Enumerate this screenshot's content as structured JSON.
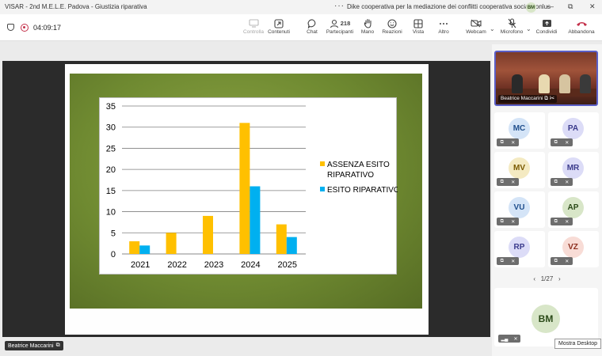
{
  "window": {
    "title": "VISAR - 2nd M.E.L.E. Padova - Giustizia riparativa",
    "organization": "Dike cooperativa per la mediazione dei conflitti cooperativa sociale onlus",
    "user_initials": "BM",
    "more_glyph": "···",
    "minimize_glyph": "—",
    "maximize_glyph": "⧉",
    "close_glyph": "✕"
  },
  "toolbar": {
    "timer": "04:09:17",
    "controlla": "Controlla",
    "contenuti": "Contenuti",
    "chat": "Chat",
    "participants_count": "218",
    "participants": "Partecipanti",
    "mano": "Mano",
    "reazioni": "Reazioni",
    "vista": "Vista",
    "altro": "Altro",
    "webcam": "Webcam",
    "microfono": "Microfono",
    "condividi": "Condividi",
    "abbandona": "Abbandona",
    "icons": {
      "controlla": "monitor-icon",
      "contenuti": "share-content-icon",
      "chat": "chat-icon",
      "participants": "people-icon",
      "mano": "hand-icon",
      "reazioni": "smile-icon",
      "vista": "grid-icon",
      "altro": "more-icon",
      "webcam": "camera-off-icon",
      "microfono": "mic-off-icon",
      "condividi": "share-icon",
      "abbandona": "phone-leave-icon"
    }
  },
  "featured": {
    "name": "Beatrice Maccarini"
  },
  "participants": [
    {
      "initials": "MC",
      "bg": "#d4e4f7",
      "fg": "#1f4e8c"
    },
    {
      "initials": "PA",
      "bg": "#dcdcf7",
      "fg": "#3b3b8c"
    },
    {
      "initials": "MV",
      "bg": "#f4eac2",
      "fg": "#7a5a00"
    },
    {
      "initials": "MR",
      "bg": "#dcdcf7",
      "fg": "#3b3b8c"
    },
    {
      "initials": "VU",
      "bg": "#d4e4f7",
      "fg": "#1f4e8c"
    },
    {
      "initials": "AP",
      "bg": "#d8e6c8",
      "fg": "#2b4a18"
    },
    {
      "initials": "RP",
      "bg": "#dcdcf7",
      "fg": "#3b3b8c"
    },
    {
      "initials": "VZ",
      "bg": "#f8dcd6",
      "fg": "#8c2f1f"
    }
  ],
  "pager": {
    "label": "1/27",
    "prev": "‹",
    "next": "›"
  },
  "big_tile": {
    "initials": "BM"
  },
  "tooltip": "Mostra Desktop",
  "presenter": "Beatrice Maccarini",
  "chart_data": {
    "type": "bar",
    "categories": [
      "2021",
      "2022",
      "2023",
      "2024",
      "2025"
    ],
    "series": [
      {
        "name": "ASSENZA ESITO RIPARATIVO",
        "values": [
          3,
          5,
          9,
          31,
          7
        ],
        "color": "#ffc000"
      },
      {
        "name": "ESITO RIPARATIVO",
        "values": [
          2,
          null,
          null,
          16,
          4
        ],
        "color": "#00b0f0"
      }
    ],
    "legend_lines": [
      [
        "ASSENZA ESITO",
        "RIPARATIVO"
      ],
      [
        "ESITO RIPARATIVO"
      ]
    ],
    "ylim": [
      0,
      35
    ],
    "yticks": [
      0,
      5,
      10,
      15,
      20,
      25,
      30,
      35
    ],
    "grid": true,
    "legend_position": "right"
  }
}
